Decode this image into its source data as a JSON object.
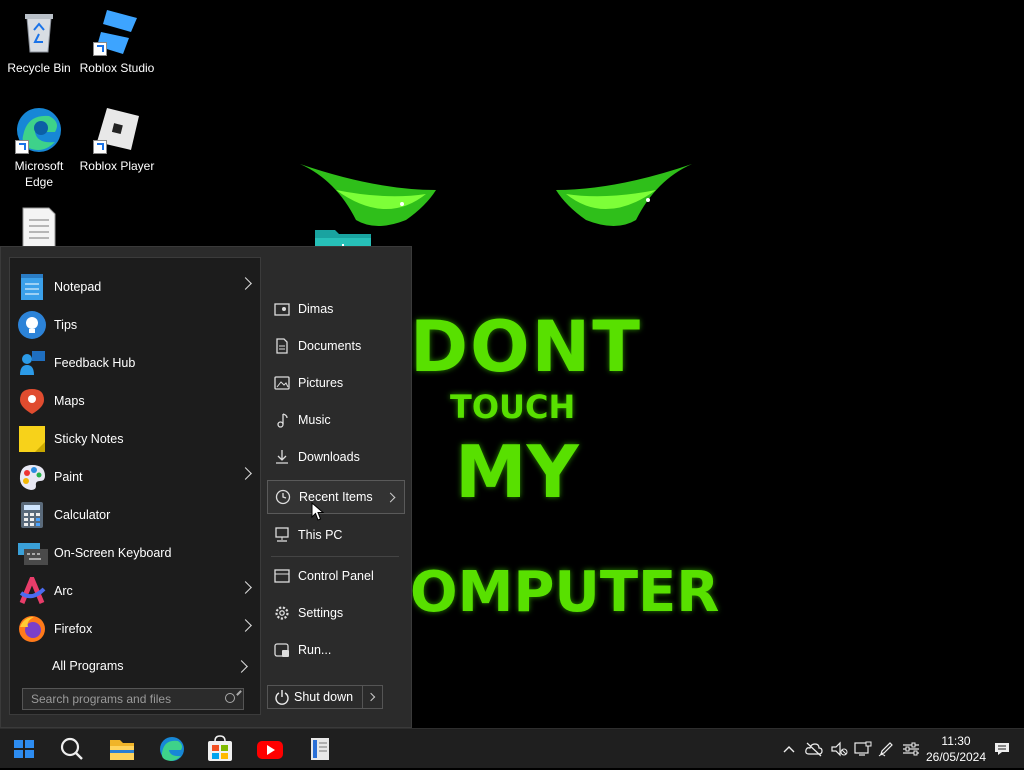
{
  "desktop": {
    "icons": [
      {
        "label": "Recycle Bin",
        "icon": "recycle-bin-icon"
      },
      {
        "label": "Roblox Studio",
        "icon": "roblox-studio-icon"
      },
      {
        "label": "Microsoft Edge",
        "icon": "edge-icon"
      },
      {
        "label": "Roblox Player",
        "icon": "roblox-player-icon"
      },
      {
        "label": "",
        "icon": "text-document-icon"
      },
      {
        "label": "",
        "icon": "downloads-folder-icon"
      }
    ]
  },
  "wallpaper": {
    "line1": "DONT",
    "line2": "TOUCH",
    "line3": "MY",
    "line4": "OMPUTER",
    "accent": "#58e000"
  },
  "start_menu": {
    "programs": [
      {
        "label": "Notepad",
        "icon": "notepad-icon",
        "has_submenu": true
      },
      {
        "label": "Tips",
        "icon": "tips-icon",
        "has_submenu": false
      },
      {
        "label": "Feedback Hub",
        "icon": "feedback-hub-icon",
        "has_submenu": false
      },
      {
        "label": "Maps",
        "icon": "maps-icon",
        "has_submenu": false
      },
      {
        "label": "Sticky Notes",
        "icon": "sticky-notes-icon",
        "has_submenu": false
      },
      {
        "label": "Paint",
        "icon": "paint-icon",
        "has_submenu": true
      },
      {
        "label": "Calculator",
        "icon": "calculator-icon",
        "has_submenu": false
      },
      {
        "label": "On-Screen Keyboard",
        "icon": "keyboard-icon",
        "has_submenu": false
      },
      {
        "label": "Arc",
        "icon": "arc-icon",
        "has_submenu": true
      },
      {
        "label": "Firefox",
        "icon": "firefox-icon",
        "has_submenu": true
      }
    ],
    "all_programs": "All Programs",
    "search_placeholder": "Search programs and files",
    "places": [
      {
        "label": "Dimas",
        "icon": "user-folder-icon"
      },
      {
        "label": "Documents",
        "icon": "document-icon"
      },
      {
        "label": "Pictures",
        "icon": "picture-icon"
      },
      {
        "label": "Music",
        "icon": "music-note-icon"
      },
      {
        "label": "Downloads",
        "icon": "download-arrow-icon"
      },
      {
        "label": "Recent Items",
        "icon": "clock-icon",
        "highlighted": true
      },
      {
        "label": "This PC",
        "icon": "computer-icon"
      },
      {
        "label": "Control Panel",
        "icon": "control-panel-icon"
      },
      {
        "label": "Settings",
        "icon": "gear-icon"
      },
      {
        "label": "Run...",
        "icon": "run-icon"
      }
    ],
    "shutdown": "Shut down"
  },
  "taskbar": {
    "pinned": [
      "start-icon",
      "search-icon",
      "file-explorer-icon",
      "edge-icon",
      "store-icon",
      "youtube-icon",
      "app-icon"
    ],
    "tray": [
      "chevron-up-icon",
      "cloud-off-icon",
      "volume-muted-icon",
      "display-icon",
      "pen-icon",
      "sliders-icon"
    ],
    "time": "11:30",
    "date": "26/05/2024"
  }
}
